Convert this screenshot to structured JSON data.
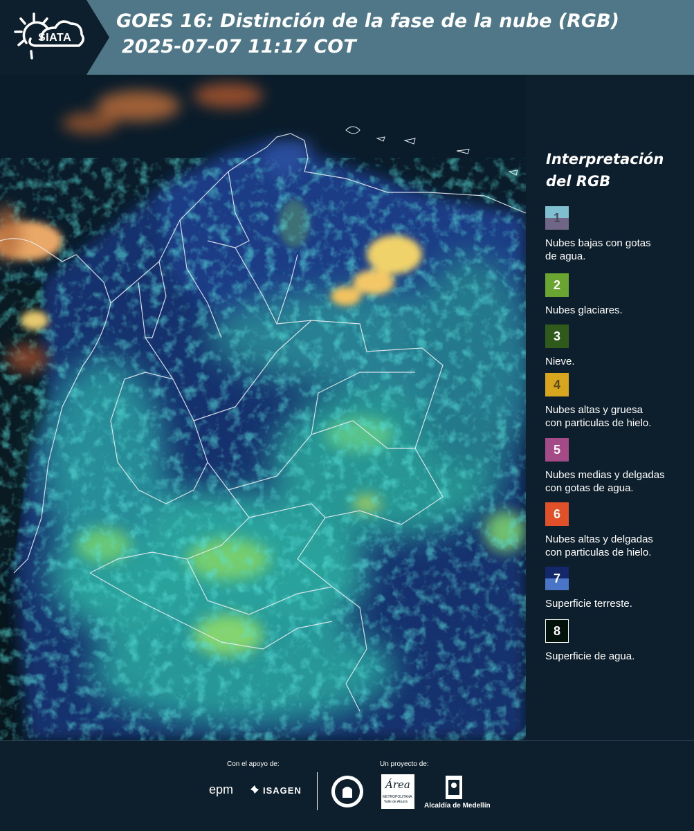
{
  "header": {
    "brand": "SIATA",
    "title_line1": "GOES 16: Distinción de la fase de la nube (RGB)",
    "title_line2": "2025-07-07 11:17 COT",
    "background_color": "#4f7787"
  },
  "legend": {
    "title_line1": "Interpretación",
    "title_line2": "del RGB",
    "items": [
      {
        "number": "1",
        "label_line1": "Nubes bajas con gotas",
        "label_line2": "de agua.",
        "color": "#7fbfd0",
        "color2": "#6f6785"
      },
      {
        "number": "2",
        "label_line1": "Nubes glaciares.",
        "label_line2": "",
        "color": "#6aa431"
      },
      {
        "number": "3",
        "label_line1": "Nieve.",
        "label_line2": "",
        "color": "#2f5a1c"
      },
      {
        "number": "4",
        "label_line1": "Nubes altas y gruesa",
        "label_line2": "con particulas de hielo.",
        "color": "#d8a51e"
      },
      {
        "number": "5",
        "label_line1": "Nubes medias y delgadas",
        "label_line2": "con gotas de agua.",
        "color": "#a44a86"
      },
      {
        "number": "6",
        "label_line1": "Nubes altas y delgadas",
        "label_line2": "con particulas de hielo.",
        "color": "#e0512a"
      },
      {
        "number": "7",
        "label_line1": "Superficie terreste.",
        "label_line2": "",
        "color": "#13276a",
        "color2": "#4a74c6"
      },
      {
        "number": "8",
        "label_line1": "Superficie de agua.",
        "label_line2": "",
        "color": "#04120c"
      }
    ]
  },
  "footer": {
    "support_label": "Con el apoyo de:",
    "project_label": "Un proyecto de:",
    "sponsors": [
      "epm",
      "ISAGEN"
    ],
    "partners": [
      "Área Metropolitana Valle de Aburrá",
      "Alcaldía de Medellín"
    ],
    "area_logo_word": "Área",
    "area_logo_sub1": "METROPOLITANA",
    "area_logo_sub2": "Valle de Aburrá",
    "alcaldia_label": "Alcaldía de Medellín"
  },
  "map": {
    "description_icon": "satellite-rgb-image"
  }
}
